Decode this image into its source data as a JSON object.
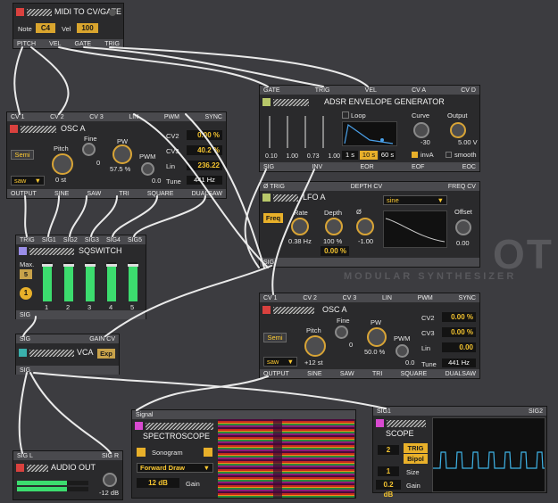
{
  "colors": {
    "accent": "#f4c430",
    "red": "#d9413e",
    "purple": "#9b8ee8",
    "teal": "#3ab0ac",
    "olive": "#b8c86a",
    "magenta": "#d84ad0",
    "meter": "#3cdc6e",
    "panel": "#2a2a2c",
    "port": "#4a4a4e"
  },
  "midi": {
    "title": "MIDI TO CV/GATE",
    "note_label": "Note",
    "note_value": "C4",
    "vel_label": "Vel",
    "vel_value": "100",
    "ports": [
      "PITCH",
      "VEL",
      "GATE",
      "TRIG"
    ]
  },
  "osc1": {
    "inputs": [
      "CV 1",
      "CV 2",
      "CV 3",
      "LIN",
      "PWM",
      "SYNC"
    ],
    "title": "OSC A",
    "semi": "Semi",
    "pitch_label": "Pitch",
    "pitch_value": "0 st",
    "fine_label": "Fine",
    "fine_value": "0",
    "pw_label": "PW",
    "pw_value": "57.5 %",
    "pwm_label": "PWM",
    "pwm_value": "0.0",
    "cv2_label": "CV2",
    "cv2_value": "0.00 %",
    "cv3_label": "CV3",
    "cv3_value": "40.2 %",
    "lin_label": "Lin",
    "lin_value": "236.22",
    "tune_label": "Tune",
    "tune_value": "441 Hz",
    "wave": "saw",
    "outputs": [
      "OUTPUT",
      "SINE",
      "SAW",
      "TRI",
      "SQUARE",
      "DUALSAW"
    ]
  },
  "adsr": {
    "inputs": [
      "GATE",
      "TRIG",
      "VEL",
      "CV A",
      "CV D"
    ],
    "title": "ADSR ENVELOPE GENERATOR",
    "loop_label": "Loop",
    "curve_label": "Curve",
    "curve_value": "-30",
    "output_label": "Output",
    "output_value": "5.00 V",
    "slider_values": [
      "0.10",
      "1.00",
      "0.73",
      "1.00"
    ],
    "ranges": [
      "1 s",
      "10 s",
      "60 s"
    ],
    "inva_label": "invA",
    "smooth_label": "smooth",
    "outputs": [
      "SIG",
      "INV",
      "EOR",
      "EOF",
      "EOC"
    ]
  },
  "lfo": {
    "inputs": [
      "Ø TRIG",
      "DEPTH CV",
      "FREQ CV"
    ],
    "title": "LFO A",
    "wave": "sine",
    "freq": "Freq",
    "rate_label": "Rate",
    "rate_value": "0.38 Hz",
    "depth_label": "Depth",
    "depth_value": "100 %",
    "phase_label": "Ø",
    "phase_value": "-1.00",
    "offset_label": "Offset",
    "offset_value": "0.00",
    "depth_cv_value": "0.00 %",
    "outputs": [
      "SIG"
    ]
  },
  "sqswitch": {
    "inputs": [
      "TRIG",
      "SIG1",
      "SIG2",
      "SIG3",
      "SIG4",
      "SIG5"
    ],
    "title": "SQSWITCH",
    "max_label": "Max.",
    "max_value": "5",
    "current": "1",
    "channels": [
      "1",
      "2",
      "3",
      "4",
      "5"
    ],
    "levels": [
      0.92,
      0.92,
      0.92,
      0.92,
      0.92
    ],
    "outputs": [
      "SIG"
    ]
  },
  "osc2": {
    "inputs": [
      "CV 1",
      "CV 2",
      "CV 3",
      "LIN",
      "PWM",
      "SYNC"
    ],
    "title": "OSC A",
    "semi": "Semi",
    "pitch_label": "Pitch",
    "pitch_value": "+12 st",
    "fine_label": "Fine",
    "fine_value": "0",
    "pw_label": "PW",
    "pw_value": "50.0 %",
    "pwm_label": "PWM",
    "pwm_value": "0.0",
    "cv2_label": "CV2",
    "cv2_value": "0.00 %",
    "cv3_label": "CV3",
    "cv3_value": "0.00 %",
    "lin_label": "Lin",
    "lin_value": "0.00",
    "tune_label": "Tune",
    "tune_value": "441 Hz",
    "wave": "saw",
    "outputs": [
      "OUTPUT",
      "SINE",
      "SAW",
      "TRI",
      "SQUARE",
      "DUALSAW"
    ]
  },
  "vca": {
    "inputs": [
      "SIG",
      "GAIN CV"
    ],
    "title": "VCA",
    "exp": "Exp",
    "outputs": [
      "SIG"
    ]
  },
  "audioout": {
    "inputs": [
      "SIG L",
      "SIG R"
    ],
    "title": "AUDIO OUT",
    "gain_value": "-12 dB"
  },
  "spectro": {
    "header": "Signal",
    "title": "SPECTROSCOPE",
    "sonogram": "Sonogram",
    "mode": "Forward Draw",
    "gain_value": "12 dB",
    "gain_label": "Gain"
  },
  "scope": {
    "inputs": [
      "SIG1",
      "SIG2"
    ],
    "title": "SCOPE",
    "ch_value": "2",
    "trig": "TRIG",
    "bipol": "Bipol",
    "size_value": "1",
    "size_label": "Size",
    "gain_value": "0.2 dB",
    "gain_label": "Gain"
  },
  "watermark": {
    "line1": "OT",
    "line2": "MODULAR SYNTHESIZER"
  }
}
